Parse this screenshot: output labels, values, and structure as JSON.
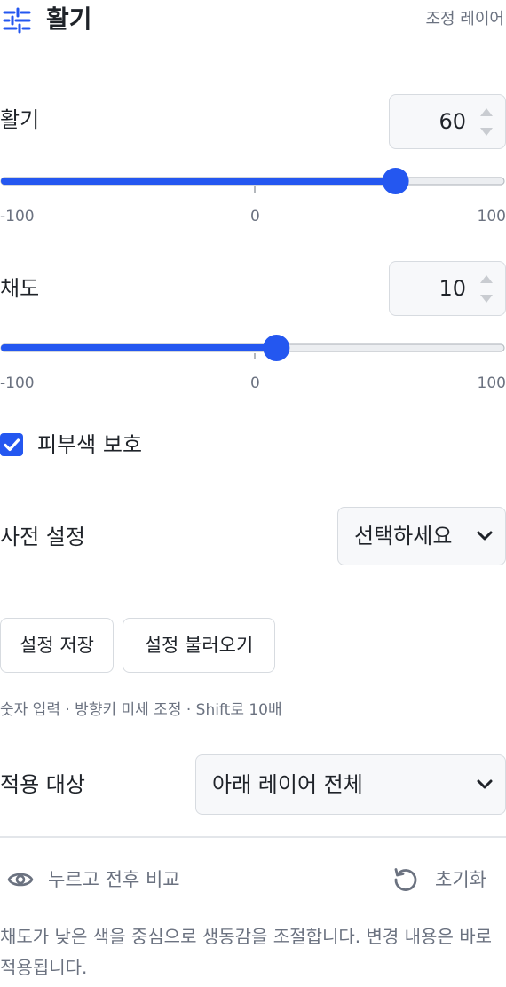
{
  "header": {
    "icon": "sliders-icon",
    "title": "활기",
    "subtitle": "조정 레이어"
  },
  "vibrance": {
    "label": "활기",
    "value": "60",
    "level": 60,
    "min": -100,
    "max": 100,
    "tick_min": "-100",
    "tick_mid": "0",
    "tick_max": "100"
  },
  "saturation": {
    "label": "채도",
    "value": "10",
    "level": 10,
    "min": -100,
    "max": 100,
    "tick_min": "-100",
    "tick_mid": "0",
    "tick_max": "100"
  },
  "skin_protect": {
    "label": "피부색 보호",
    "checked": true
  },
  "preset": {
    "label": "사전 설정",
    "selected": "선택하세요"
  },
  "buttons": {
    "save": "설정 저장",
    "load": "설정 불러오기"
  },
  "hint": "숫자 입력 · 방향키 미세 조정 · Shift로 10배",
  "apply_to": {
    "label": "적용 대상",
    "selected": "아래 레이어 전체"
  },
  "compare": {
    "icon": "eye-icon",
    "label": "누르고 전후 비교"
  },
  "reset": {
    "icon": "reset-icon",
    "label": "초기화"
  },
  "description": "채도가 낮은 색을 중심으로 생동감을 조절합니다. 변경 내용은 바로 적용됩니다.",
  "colors": {
    "accent": "#2457f0",
    "text": "#1f2329",
    "muted": "#6b7280",
    "border": "#d7dbe0"
  }
}
